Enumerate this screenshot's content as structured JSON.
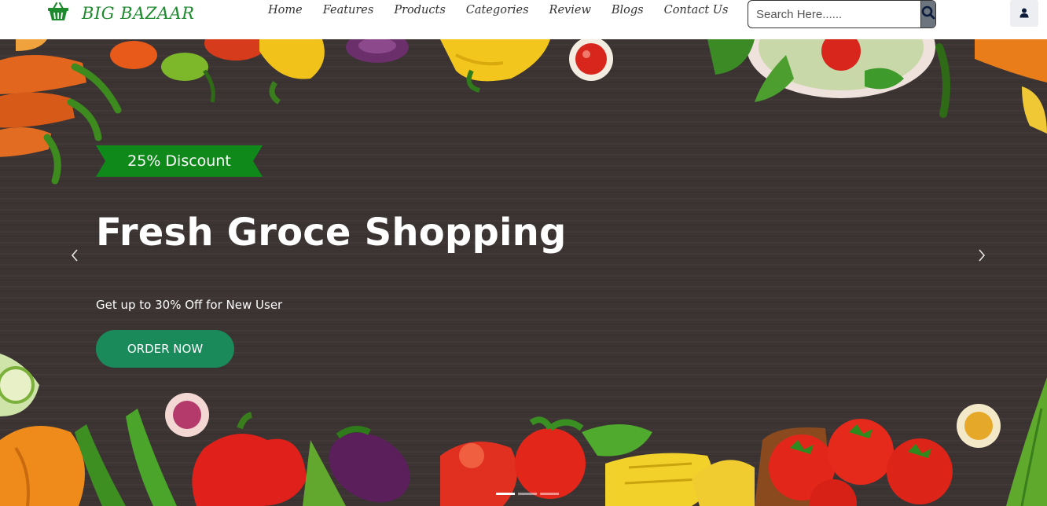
{
  "brand": {
    "name": "BIG BAZAAR",
    "icon": "basket-icon",
    "color": "#1e8a2e"
  },
  "nav": {
    "links": [
      {
        "label": "Home"
      },
      {
        "label": "Features"
      },
      {
        "label": "Products"
      },
      {
        "label": "Categories"
      },
      {
        "label": "Review"
      },
      {
        "label": "Blogs"
      },
      {
        "label": "Contact Us"
      }
    ]
  },
  "search": {
    "placeholder": "Search Here......",
    "value": "",
    "icon": "search-icon"
  },
  "user": {
    "icon": "user-icon"
  },
  "hero": {
    "badge": "25% Discount",
    "title": "Fresh Groce Shopping",
    "subtitle": "Get up to 30% Off for New User",
    "cta": "ORDER NOW",
    "prev_icon": "chevron-left-icon",
    "next_icon": "chevron-right-icon",
    "slide_count": 3,
    "active_slide": 1
  },
  "colors": {
    "badge_green": "#0f8a1a",
    "cta_green": "#1b8a5a",
    "board_dark": "#3b3433"
  }
}
